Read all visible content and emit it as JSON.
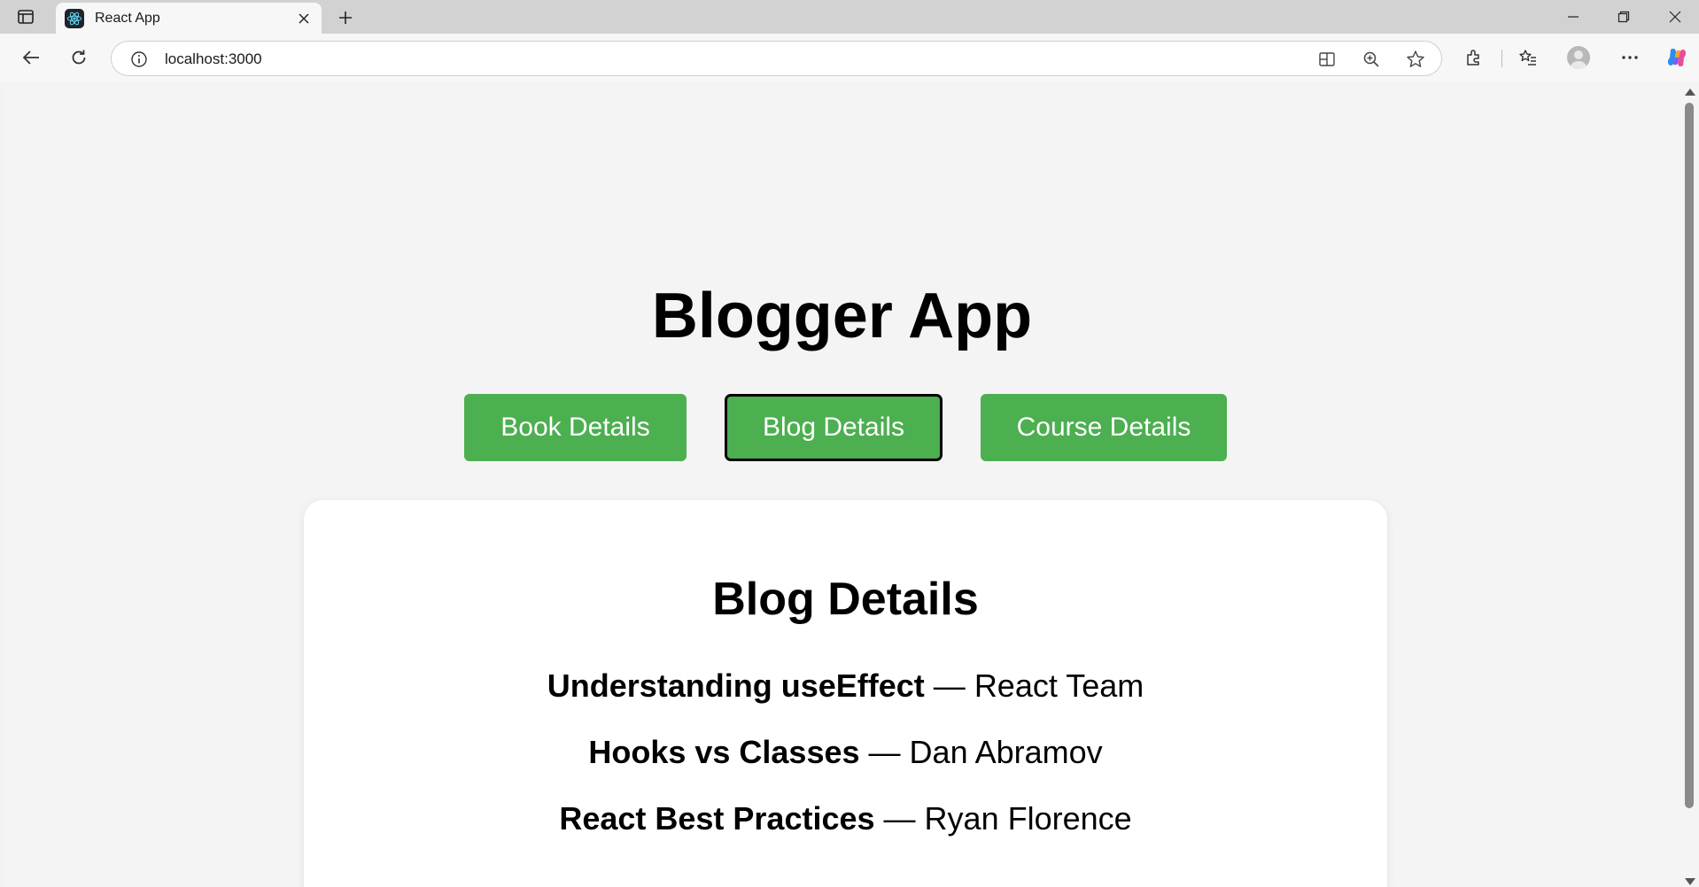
{
  "browser": {
    "tab_title": "React App",
    "url": "localhost:3000"
  },
  "app": {
    "title": "Blogger App",
    "nav": {
      "book": "Book Details",
      "blog": "Blog Details",
      "course": "Course Details",
      "active": "blog"
    },
    "panel": {
      "title": "Blog Details",
      "items": [
        {
          "title": "Understanding useEffect",
          "separator": " — ",
          "author": "React Team"
        },
        {
          "title": "Hooks vs Classes",
          "separator": " — ",
          "author": "Dan Abramov"
        },
        {
          "title": "React Best Practices",
          "separator": " — ",
          "author": "Ryan Florence"
        }
      ]
    }
  },
  "colors": {
    "button_green": "#4caf50",
    "page_background": "#f4f4f4",
    "card_background": "#ffffff"
  }
}
